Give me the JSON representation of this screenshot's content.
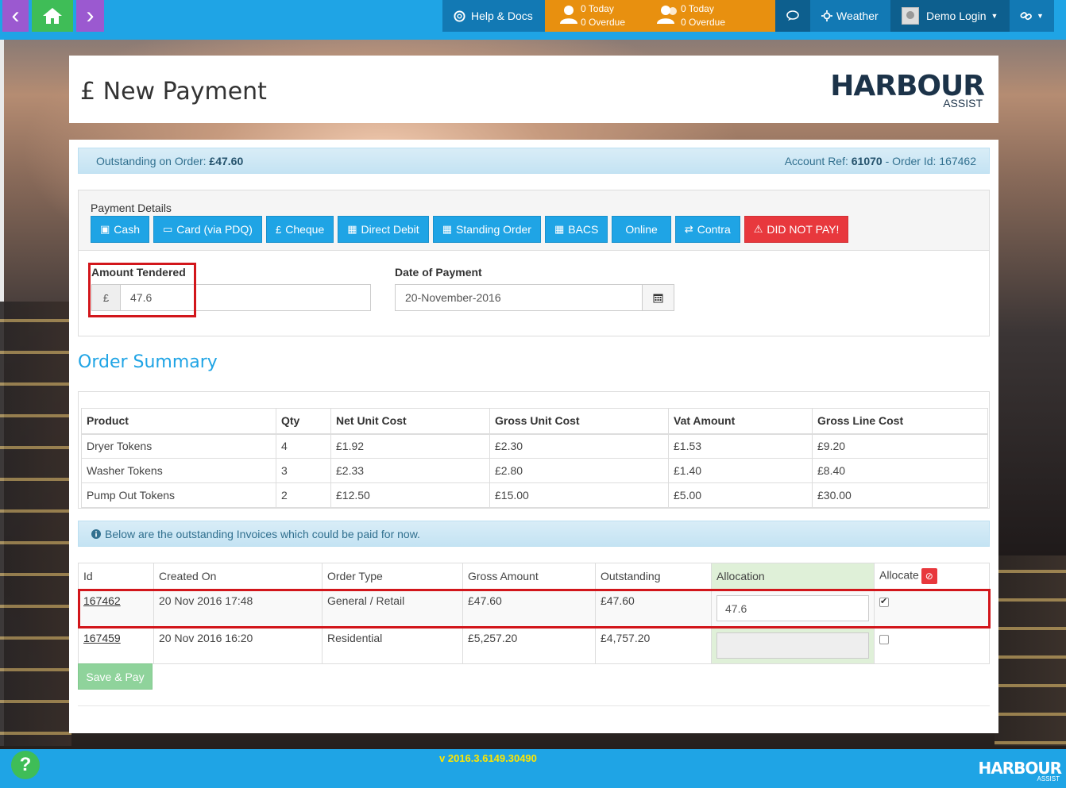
{
  "nav": {
    "back_icon": "‹",
    "home_icon": "⌂",
    "forward_icon": "›"
  },
  "topbar": {
    "help": "Help & Docs",
    "counter1": {
      "today": "0 Today",
      "overdue": "0 Overdue"
    },
    "counter2": {
      "today": "0 Today",
      "overdue": "0 Overdue"
    },
    "weather": "Weather",
    "login": "Demo Login"
  },
  "header": {
    "title": "£ New Payment",
    "logo_main": "HARBOUR",
    "logo_sub": "ASSIST"
  },
  "info": {
    "outstanding_label": "Outstanding on Order:",
    "outstanding_value": "£47.60",
    "account_label": "Account Ref:",
    "account_value": "61070",
    "order_label": "- Order Id: 167462"
  },
  "payment": {
    "label": "Payment Details",
    "buttons": [
      {
        "label": "Cash"
      },
      {
        "label": "Card (via PDQ)"
      },
      {
        "label": "Cheque"
      },
      {
        "label": "Direct Debit"
      },
      {
        "label": "Standing Order"
      },
      {
        "label": "BACS"
      },
      {
        "label": "Online"
      },
      {
        "label": "Contra"
      },
      {
        "label": "DID NOT PAY!"
      }
    ],
    "amount_label": "Amount Tendered",
    "currency": "£",
    "amount_value": "47.6",
    "date_label": "Date of Payment",
    "date_value": "20-November-2016"
  },
  "order_summary": {
    "title": "Order Summary",
    "columns": [
      "Product",
      "Qty",
      "Net Unit Cost",
      "Gross Unit Cost",
      "Vat Amount",
      "Gross Line Cost"
    ],
    "rows": [
      [
        "Dryer Tokens",
        "4",
        "£1.92",
        "£2.30",
        "£1.53",
        "£9.20"
      ],
      [
        "Washer Tokens",
        "3",
        "£2.33",
        "£2.80",
        "£1.40",
        "£8.40"
      ],
      [
        "Pump Out Tokens",
        "2",
        "£12.50",
        "£15.00",
        "£5.00",
        "£30.00"
      ]
    ]
  },
  "invoices": {
    "notice": "Below are the outstanding Invoices which could be paid for now.",
    "columns": [
      "Id",
      "Created On",
      "Order Type",
      "Gross Amount",
      "Outstanding",
      "Allocation",
      "Allocate"
    ],
    "rows": [
      {
        "id": "167462",
        "created": "20 Nov 2016 17:48",
        "type": "General / Retail",
        "gross": "£47.60",
        "outstanding": "£47.60",
        "allocation": "47.6",
        "checked": true
      },
      {
        "id": "167459",
        "created": "20 Nov 2016 16:20",
        "type": "Residential",
        "gross": "£5,257.20",
        "outstanding": "£4,757.20",
        "allocation": "",
        "checked": false
      }
    ]
  },
  "save_label": "Save & Pay",
  "footer": {
    "help_icon": "?",
    "version": "v 2016.3.6149.30490",
    "logo": "HARBOUR",
    "logo_sub": "ASSIST"
  },
  "colors": {
    "primary": "#1fa4e5",
    "orange": "#e8900f",
    "danger": "#e8383d",
    "success": "#3fbd57"
  }
}
